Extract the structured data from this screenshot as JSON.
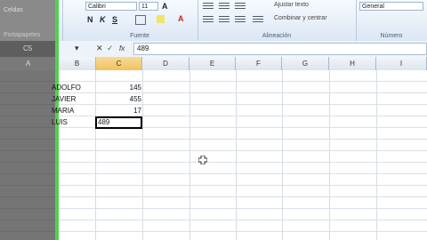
{
  "ribbon": {
    "font_name": "Calibri",
    "font_size": "11",
    "bold_label": "N",
    "italic_label": "K",
    "underline_label": "S",
    "font_color_label": "A",
    "grow_font_label": "A",
    "wrap_text_label": "Ajustar texto",
    "merge_center_label": "Combinar y centrar",
    "number_format": "General",
    "groups": {
      "font": "Fuente",
      "alignment": "Alineación",
      "number": "Número"
    }
  },
  "left_panel": {
    "title": "Celdas",
    "label_2": "Portapapeles",
    "cell_ref": "C5"
  },
  "formula_bar": {
    "cancel_symbol": "✕",
    "enter_symbol": "✓",
    "function_symbol": "fx",
    "value": "489"
  },
  "columns": [
    "A",
    "B",
    "C",
    "D",
    "E",
    "F",
    "G",
    "H",
    "I"
  ],
  "rows": [
    {
      "name": "ADOLFO",
      "value": "145"
    },
    {
      "name": "JAVIER",
      "value": "455"
    },
    {
      "name": "MARIA",
      "value": "17"
    },
    {
      "name": "LUIS",
      "value": ""
    }
  ],
  "active_cell": {
    "ref": "C5",
    "editing_value": "489"
  }
}
